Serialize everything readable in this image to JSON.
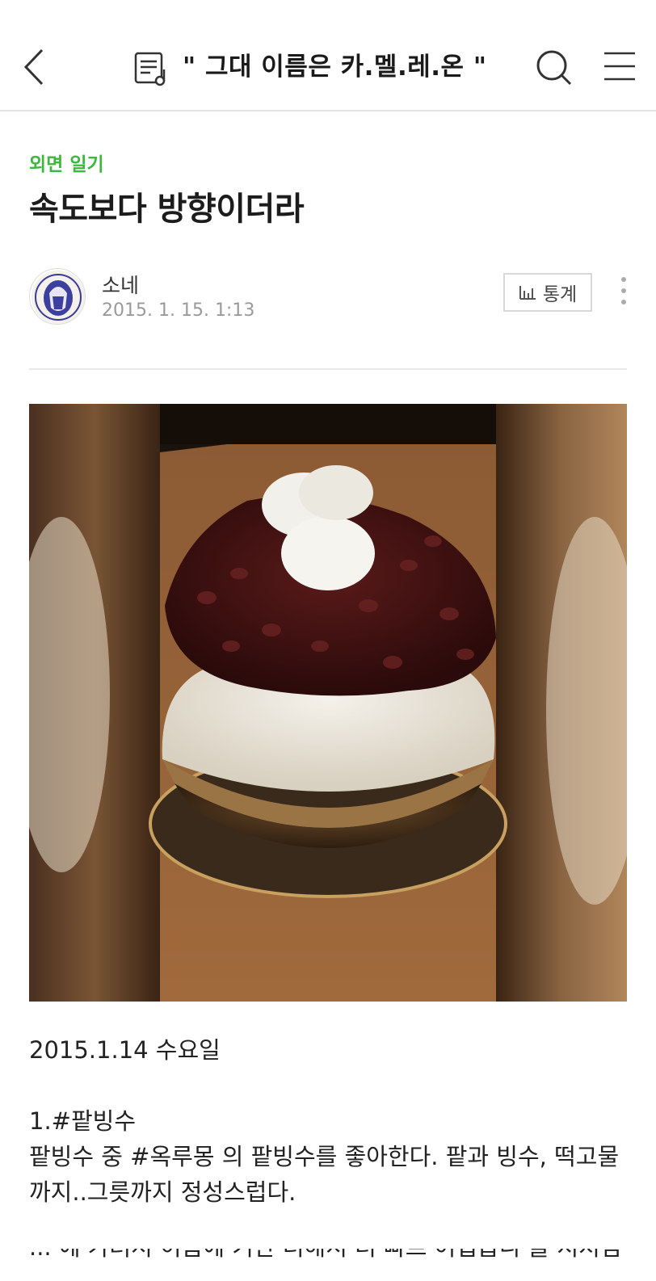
{
  "header": {
    "blog_title": "\" 그대 이름은 카.멜.레.온 \"",
    "icons": [
      "back-icon",
      "blog-list-icon",
      "search-icon",
      "menu-icon"
    ]
  },
  "post": {
    "category": "외면 일기",
    "title": "속도보다 방향이더라",
    "author": "소네",
    "date": "2015. 1. 15. 1:13",
    "stats_label": "통계"
  },
  "content": {
    "date_line": "2015.1.14 수요일",
    "heading": "1.#팥빙수",
    "paragraph": "팥빙수 중 #옥루몽 의 팥빙수를 좋아한다. 팥과 빙수, 떡고물까지..그릇까지 정성스럽다.",
    "cut_line": "... 에 가려서 이름에 기반 더해서 더 빠르 어렵습니 줄 저처럼"
  },
  "colors": {
    "accent_green": "#3db83d",
    "divider": "#e3e3e3"
  }
}
